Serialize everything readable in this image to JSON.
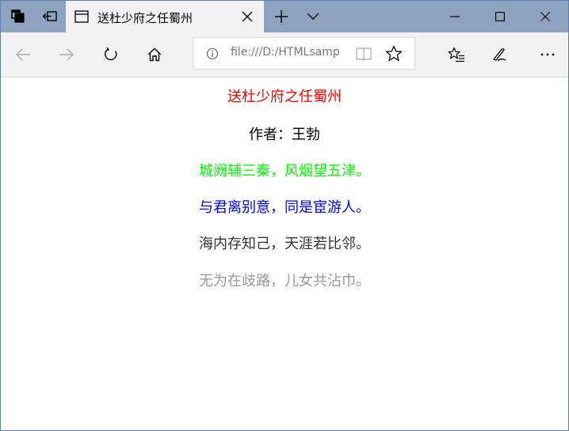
{
  "tab": {
    "title": "送杜少府之任蜀州"
  },
  "address_bar": {
    "url": "file:///D:/HTMLsamp"
  },
  "poem": {
    "title": "送杜少府之任蜀州",
    "author": "作者：王勃",
    "lines": [
      "城阙辅三秦，风烟望五津。",
      "与君离别意，同是宦游人。",
      "海内存知己，天涯若比邻。",
      "无为在歧路，儿女共沾巾。"
    ]
  },
  "colors": {
    "title": "#ff0000",
    "author": "#000000",
    "line1": "#00ff00",
    "line2": "#0000ff",
    "line3": "#333333",
    "line4": "#999999",
    "tabbar": "#8ea3c0",
    "chrome": "#f2f2f2"
  }
}
